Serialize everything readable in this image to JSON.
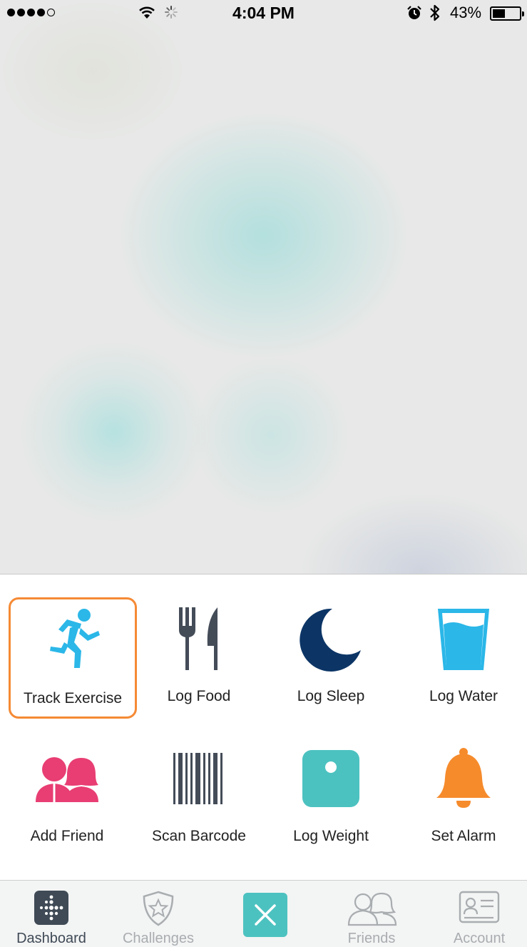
{
  "status_bar": {
    "time": "4:04 PM",
    "battery_percent": "43%",
    "signal_bars": 4,
    "signal_total": 5,
    "battery_level": 0.43,
    "icons": [
      "wifi-icon",
      "activity-spinner-icon",
      "alarm-clock-icon",
      "bluetooth-icon",
      "battery-icon"
    ]
  },
  "quick_actions": [
    {
      "label": "Track Exercise",
      "icon": "running-person-icon",
      "color": "#2bb7e8",
      "selected": true
    },
    {
      "label": "Log Food",
      "icon": "fork-knife-icon",
      "color": "#444c58",
      "selected": false
    },
    {
      "label": "Log Sleep",
      "icon": "moon-icon",
      "color": "#0c3566",
      "selected": false
    },
    {
      "label": "Log Water",
      "icon": "water-glass-icon",
      "color": "#2bb7e8",
      "selected": false
    },
    {
      "label": "Add Friend",
      "icon": "people-icon",
      "color": "#e83e73",
      "selected": false
    },
    {
      "label": "Scan Barcode",
      "icon": "barcode-icon",
      "color": "#444c58",
      "selected": false
    },
    {
      "label": "Log Weight",
      "icon": "scale-icon",
      "color": "#4cc2c0",
      "selected": false
    },
    {
      "label": "Set Alarm",
      "icon": "bell-icon",
      "color": "#f68b2c",
      "selected": false
    }
  ],
  "selection_color": "#f58a35",
  "tab_bar": {
    "tabs": [
      {
        "label": "Dashboard",
        "icon": "fitbit-dots-icon",
        "active": true
      },
      {
        "label": "Challenges",
        "icon": "star-shield-icon",
        "active": false
      },
      {
        "label": "Friends",
        "icon": "friends-outline-icon",
        "active": false
      },
      {
        "label": "Account",
        "icon": "id-card-icon",
        "active": false
      }
    ],
    "close_icon": "close-icon",
    "close_color": "#4cc2c0"
  }
}
